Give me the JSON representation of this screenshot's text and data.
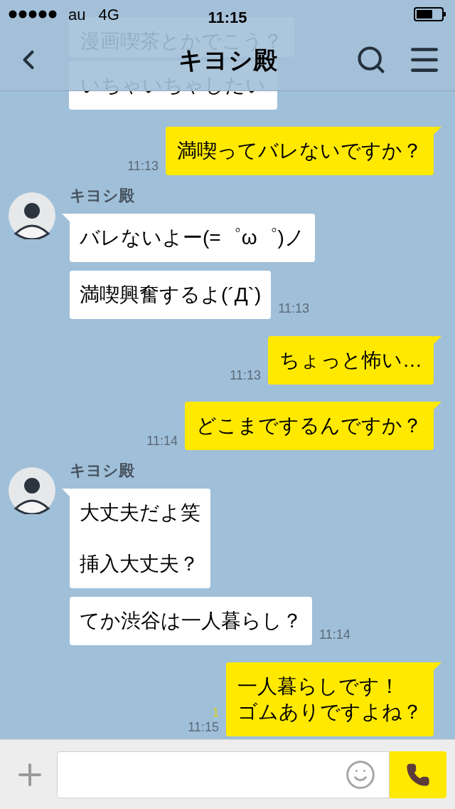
{
  "status_bar": {
    "carrier": "au",
    "network": "4G",
    "time": "11:15"
  },
  "header": {
    "title": "キヨシ殿"
  },
  "messages": [
    {
      "kind": "partial",
      "paragraphs": [
        [
          "漫画喫茶とかでこう？"
        ]
      ]
    },
    {
      "kind": "partial",
      "paragraphs": [
        [
          "いちゃいちゃしたい"
        ]
      ]
    },
    {
      "kind": "sent",
      "paragraphs": [
        [
          "満喫ってバレないですか？"
        ]
      ],
      "time": "11:13"
    },
    {
      "kind": "received",
      "sender": "キヨシ殿",
      "bubbles": [
        {
          "paragraphs": [
            [
              "バレないよー(=゜ω゜)ノ"
            ]
          ]
        },
        {
          "paragraphs": [
            [
              "満喫興奮するよ(´Д`)"
            ]
          ],
          "time": "11:13"
        }
      ]
    },
    {
      "kind": "sent",
      "paragraphs": [
        [
          "ちょっと怖い…"
        ]
      ],
      "time": "11:13"
    },
    {
      "kind": "sent",
      "paragraphs": [
        [
          "どこまでするんですか？"
        ]
      ],
      "time": "11:14"
    },
    {
      "kind": "received",
      "sender": "キヨシ殿",
      "bubbles": [
        {
          "paragraphs": [
            [
              "大丈夫だよ笑"
            ],
            [
              "挿入大丈夫？"
            ]
          ]
        },
        {
          "paragraphs": [
            [
              "てか渋谷は一人暮らし？"
            ]
          ],
          "time": "11:14"
        }
      ]
    },
    {
      "kind": "sent",
      "paragraphs": [
        [
          "一人暮らしです！",
          "ゴムありですよね？"
        ]
      ],
      "time": "11:15",
      "read": "1"
    }
  ]
}
